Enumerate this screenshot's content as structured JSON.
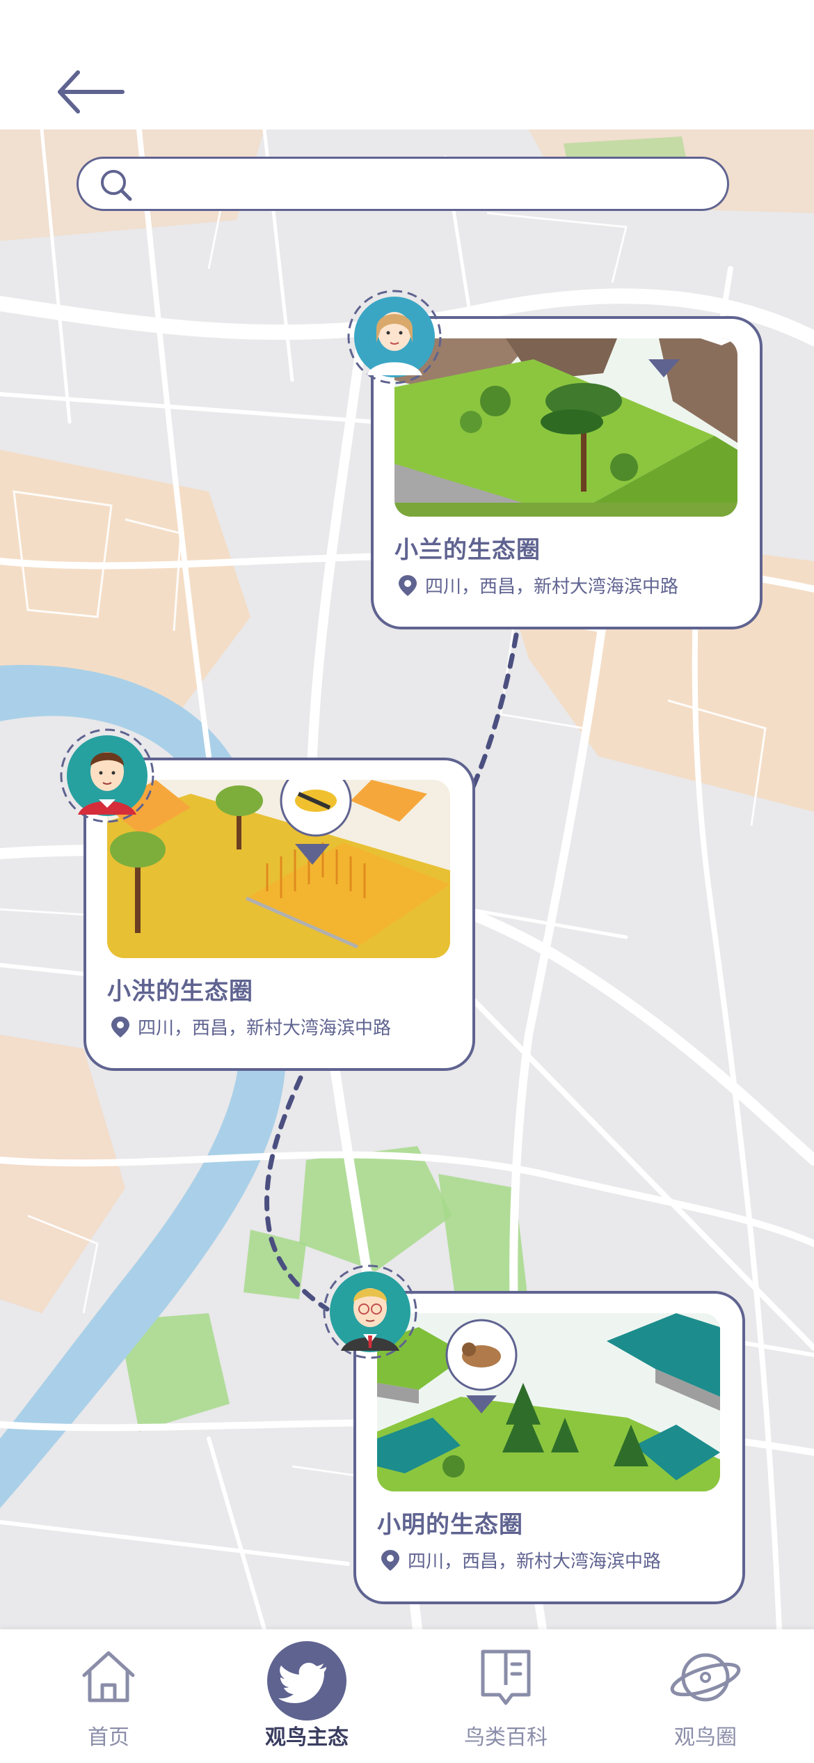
{
  "header": {
    "back_icon": "arrow-left-icon"
  },
  "search": {
    "placeholder": "",
    "value": "",
    "icon": "search-icon"
  },
  "cards": [
    {
      "title": "小兰的生态圈",
      "location": "四川，西昌，新村大湾海滨中路",
      "avatar": "girl-avatar"
    },
    {
      "title": "小洪的生态圈",
      "location": "四川，西昌，新村大湾海滨中路",
      "avatar": "boy-avatar"
    },
    {
      "title": "小明的生态圈",
      "location": "四川，西昌，新村大湾海滨中路",
      "avatar": "man-avatar"
    }
  ],
  "tabs": [
    {
      "label": "首页",
      "icon": "home-icon",
      "active": false
    },
    {
      "label": "观鸟主态",
      "icon": "twitter-bird-icon",
      "active": true
    },
    {
      "label": "鸟类百科",
      "icon": "book-icon",
      "active": false
    },
    {
      "label": "观鸟圈",
      "icon": "planet-icon",
      "active": false
    }
  ],
  "colors": {
    "accent": "#5f6390",
    "map_bg": "#e9e8ea",
    "river": "#a9d0e8",
    "park": "#a6d98a",
    "sand": "#f6d9bd"
  }
}
